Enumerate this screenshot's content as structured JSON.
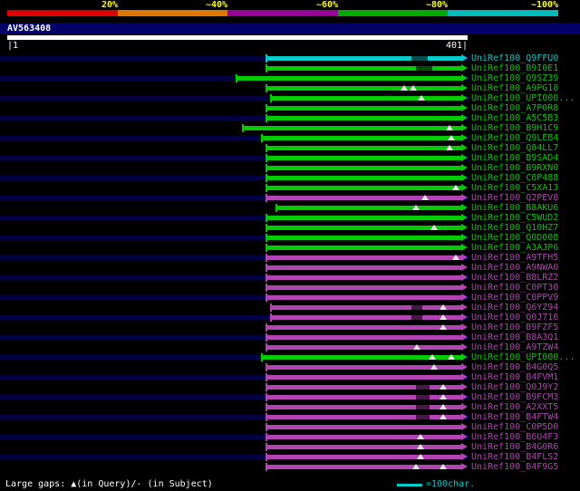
{
  "colors": {
    "green": "#00cc00",
    "purple": "#b344b3",
    "cyan": "#00cccc",
    "row_stripe": "#000042",
    "title_strip": "#000066",
    "scale_label_yellow": "#ffff00",
    "query_bar_white": "#ffffff",
    "legend_cyan": "#00cccc"
  },
  "chart_data": {
    "type": "bar",
    "subtype": "blast-alignment-overview",
    "orientation": "horizontal",
    "query": {
      "name": "AV563408",
      "start": 1,
      "end": 401,
      "left_label": "|1",
      "right_label": "401|"
    },
    "identity_scale": {
      "labels": [
        "20%",
        "~40%",
        "~60%",
        "~80%",
        "~100%"
      ],
      "colors": [
        "#dd0000",
        "#dd7700",
        "#990099",
        "#00aa00",
        "#00bbbb"
      ]
    },
    "hits": [
      {
        "id": "UniRef100_Q9FFU0",
        "color": "cyan",
        "align_start": 226,
        "align_end": 401,
        "query_gap_positions": [],
        "low_identity_segments": [
          [
            352,
            366
          ]
        ]
      },
      {
        "id": "UniRef100_B9I0E1",
        "color": "green",
        "align_start": 226,
        "align_end": 401,
        "query_gap_positions": [],
        "low_identity_segments": [
          [
            356,
            370
          ]
        ]
      },
      {
        "id": "UniRef100_Q9SZ39",
        "color": "green",
        "align_start": 200,
        "align_end": 401,
        "query_gap_positions": [],
        "low_identity_segments": []
      },
      {
        "id": "UniRef100_A9PG18",
        "color": "green",
        "align_start": 226,
        "align_end": 401,
        "query_gap_positions": [
          346,
          354
        ],
        "low_identity_segments": []
      },
      {
        "id": "UniRef100_UPI000...",
        "color": "green",
        "align_start": 230,
        "align_end": 401,
        "query_gap_positions": [
          361
        ],
        "low_identity_segments": []
      },
      {
        "id": "UniRef100_A7P0R8",
        "color": "green",
        "align_start": 226,
        "align_end": 401,
        "query_gap_positions": [],
        "low_identity_segments": []
      },
      {
        "id": "UniRef100_A5C5B3",
        "color": "green",
        "align_start": 226,
        "align_end": 401,
        "query_gap_positions": [],
        "low_identity_segments": []
      },
      {
        "id": "UniRef100_B9H1C9",
        "color": "green",
        "align_start": 206,
        "align_end": 401,
        "query_gap_positions": [
          385
        ],
        "low_identity_segments": []
      },
      {
        "id": "UniRef100_Q9LEB4",
        "color": "green",
        "align_start": 222,
        "align_end": 401,
        "query_gap_positions": [
          387
        ],
        "low_identity_segments": []
      },
      {
        "id": "UniRef100_Q84LL7",
        "color": "green",
        "align_start": 226,
        "align_end": 401,
        "query_gap_positions": [
          385
        ],
        "low_identity_segments": []
      },
      {
        "id": "UniRef100_B9SAD4",
        "color": "green",
        "align_start": 226,
        "align_end": 401,
        "query_gap_positions": [],
        "low_identity_segments": []
      },
      {
        "id": "UniRef100_B9RXN0",
        "color": "green",
        "align_start": 226,
        "align_end": 401,
        "query_gap_positions": [],
        "low_identity_segments": []
      },
      {
        "id": "UniRef100_C6P488",
        "color": "green",
        "align_start": 226,
        "align_end": 401,
        "query_gap_positions": [],
        "low_identity_segments": []
      },
      {
        "id": "UniRef100_C5XA13",
        "color": "green",
        "align_start": 226,
        "align_end": 401,
        "query_gap_positions": [
          391
        ],
        "low_identity_segments": []
      },
      {
        "id": "UniRef100_Q2PEV8",
        "color": "purple",
        "align_start": 226,
        "align_end": 401,
        "query_gap_positions": [
          364
        ],
        "low_identity_segments": []
      },
      {
        "id": "UniRef100_B8AKU6",
        "color": "green",
        "align_start": 235,
        "align_end": 401,
        "query_gap_positions": [
          356
        ],
        "low_identity_segments": []
      },
      {
        "id": "UniRef100_C5WUD2",
        "color": "green",
        "align_start": 226,
        "align_end": 401,
        "query_gap_positions": [],
        "low_identity_segments": []
      },
      {
        "id": "UniRef100_Q10HZ7",
        "color": "green",
        "align_start": 226,
        "align_end": 401,
        "query_gap_positions": [
          372
        ],
        "low_identity_segments": []
      },
      {
        "id": "UniRef100_Q0D008",
        "color": "green",
        "align_start": 226,
        "align_end": 401,
        "query_gap_positions": [],
        "low_identity_segments": []
      },
      {
        "id": "UniRef100_A3AJP6",
        "color": "green",
        "align_start": 226,
        "align_end": 401,
        "query_gap_positions": [],
        "low_identity_segments": []
      },
      {
        "id": "UniRef100_A9TFH5",
        "color": "purple",
        "align_start": 226,
        "align_end": 401,
        "query_gap_positions": [
          391
        ],
        "low_identity_segments": []
      },
      {
        "id": "UniRef100_A9NWA0",
        "color": "purple",
        "align_start": 226,
        "align_end": 401,
        "query_gap_positions": [],
        "low_identity_segments": []
      },
      {
        "id": "UniRef100_B8LRZ2",
        "color": "purple",
        "align_start": 226,
        "align_end": 401,
        "query_gap_positions": [],
        "low_identity_segments": []
      },
      {
        "id": "UniRef100_C0PT30",
        "color": "purple",
        "align_start": 226,
        "align_end": 401,
        "query_gap_positions": [],
        "low_identity_segments": []
      },
      {
        "id": "UniRef100_C0PPV9",
        "color": "purple",
        "align_start": 226,
        "align_end": 401,
        "query_gap_positions": [],
        "low_identity_segments": []
      },
      {
        "id": "UniRef100_Q6YZ94",
        "color": "purple",
        "align_start": 230,
        "align_end": 401,
        "query_gap_positions": [
          380
        ],
        "low_identity_segments": [
          [
            352,
            362
          ]
        ]
      },
      {
        "id": "UniRef100_Q0J716",
        "color": "purple",
        "align_start": 230,
        "align_end": 401,
        "query_gap_positions": [
          380
        ],
        "low_identity_segments": [
          [
            352,
            362
          ]
        ]
      },
      {
        "id": "UniRef100_B9FZF5",
        "color": "purple",
        "align_start": 226,
        "align_end": 401,
        "query_gap_positions": [
          380
        ],
        "low_identity_segments": []
      },
      {
        "id": "UniRef100_B8A3Q1",
        "color": "purple",
        "align_start": 226,
        "align_end": 401,
        "query_gap_positions": [],
        "low_identity_segments": []
      },
      {
        "id": "UniRef100_A9TZW4",
        "color": "purple",
        "align_start": 226,
        "align_end": 401,
        "query_gap_positions": [
          357
        ],
        "low_identity_segments": []
      },
      {
        "id": "UniRef100_UPI000...",
        "color": "green",
        "align_start": 222,
        "align_end": 401,
        "query_gap_positions": [
          370,
          387
        ],
        "low_identity_segments": []
      },
      {
        "id": "UniRef100_B4G0Q5",
        "color": "purple",
        "align_start": 226,
        "align_end": 401,
        "query_gap_positions": [
          372
        ],
        "low_identity_segments": []
      },
      {
        "id": "UniRef100_B4FVM1",
        "color": "purple",
        "align_start": 226,
        "align_end": 401,
        "query_gap_positions": [],
        "low_identity_segments": []
      },
      {
        "id": "UniRef100_Q0J9Y2",
        "color": "purple",
        "align_start": 226,
        "align_end": 401,
        "query_gap_positions": [
          380
        ],
        "low_identity_segments": [
          [
            356,
            368
          ]
        ]
      },
      {
        "id": "UniRef100_B9FCM3",
        "color": "purple",
        "align_start": 226,
        "align_end": 401,
        "query_gap_positions": [
          380
        ],
        "low_identity_segments": [
          [
            356,
            368
          ]
        ]
      },
      {
        "id": "UniRef100_A2XXT5",
        "color": "purple",
        "align_start": 226,
        "align_end": 401,
        "query_gap_positions": [
          380
        ],
        "low_identity_segments": [
          [
            356,
            368
          ]
        ]
      },
      {
        "id": "UniRef100_B4FTW4",
        "color": "purple",
        "align_start": 226,
        "align_end": 401,
        "query_gap_positions": [
          380
        ],
        "low_identity_segments": [
          [
            356,
            368
          ]
        ]
      },
      {
        "id": "UniRef100_C0P5D0",
        "color": "purple",
        "align_start": 226,
        "align_end": 401,
        "query_gap_positions": [],
        "low_identity_segments": []
      },
      {
        "id": "UniRef100_B6U4F3",
        "color": "purple",
        "align_start": 226,
        "align_end": 401,
        "query_gap_positions": [
          360
        ],
        "low_identity_segments": []
      },
      {
        "id": "UniRef100_B4G0R6",
        "color": "purple",
        "align_start": 226,
        "align_end": 401,
        "query_gap_positions": [
          360
        ],
        "low_identity_segments": []
      },
      {
        "id": "UniRef100_B4FLS2",
        "color": "purple",
        "align_start": 226,
        "align_end": 401,
        "query_gap_positions": [
          360
        ],
        "low_identity_segments": []
      },
      {
        "id": "UniRef100_B4F9G5",
        "color": "purple",
        "align_start": 226,
        "align_end": 401,
        "query_gap_positions": [
          356,
          380
        ],
        "low_identity_segments": []
      }
    ]
  },
  "footer": {
    "gaps_legend": "Large gaps: ▲(in Query)/- (in Subject)",
    "scale_bar_label": "=100char."
  }
}
